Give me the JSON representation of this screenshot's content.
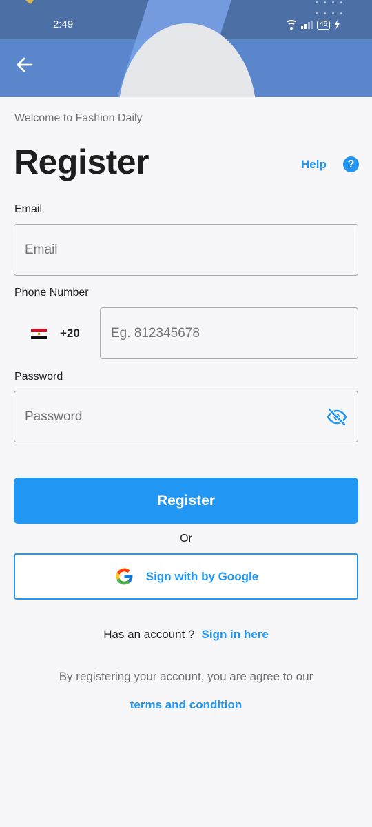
{
  "status_bar": {
    "time": "2:49",
    "battery": "46"
  },
  "header": {
    "back_icon": "arrow-left-icon"
  },
  "page": {
    "welcome": "Welcome to Fashion Daily",
    "title": "Register",
    "help_label": "Help",
    "help_icon_glyph": "?"
  },
  "form": {
    "email_label": "Email",
    "email_placeholder": "Email",
    "phone_label": "Phone Number",
    "country_dial": "+20",
    "phone_placeholder": "Eg. 812345678",
    "password_label": "Password",
    "password_placeholder": "Password"
  },
  "actions": {
    "register_label": "Register",
    "or_label": "Or",
    "google_label": "Sign with by Google"
  },
  "footer": {
    "has_account": "Has an account ?",
    "sign_in_link": "Sign in here",
    "agreement": "By registering your account, you are agree to our",
    "terms_link": "terms and condition"
  },
  "colors": {
    "accent": "#2196f3",
    "header": "#5a86cc",
    "background": "#f7f7f9"
  }
}
